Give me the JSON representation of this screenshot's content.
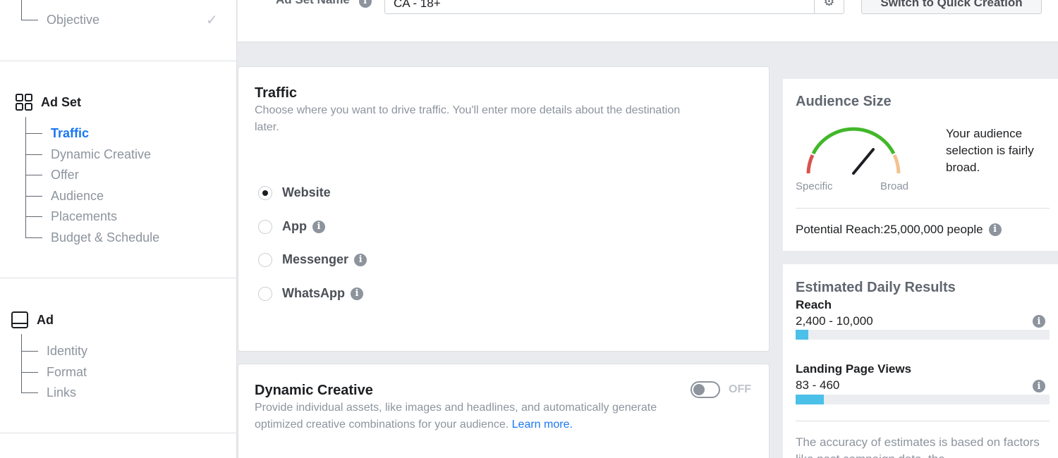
{
  "sidebar": {
    "objective": {
      "label": "Objective",
      "check": "✓"
    },
    "adset": {
      "title": "Ad Set",
      "items": [
        {
          "label": "Traffic",
          "active": true
        },
        {
          "label": "Dynamic Creative"
        },
        {
          "label": "Offer"
        },
        {
          "label": "Audience"
        },
        {
          "label": "Placements"
        },
        {
          "label": "Budget & Schedule"
        }
      ]
    },
    "ad": {
      "title": "Ad",
      "items": [
        {
          "label": "Identity"
        },
        {
          "label": "Format"
        },
        {
          "label": "Links"
        }
      ]
    }
  },
  "topbar": {
    "name_label": "Ad Set Name",
    "name_value": "CA - 18+",
    "quick_button": "Switch to Quick Creation"
  },
  "traffic": {
    "title": "Traffic",
    "description": "Choose where you want to drive traffic. You'll enter more details about the destination later.",
    "options": [
      {
        "label": "Website",
        "selected": true,
        "info": false
      },
      {
        "label": "App",
        "selected": false,
        "info": true
      },
      {
        "label": "Messenger",
        "selected": false,
        "info": true
      },
      {
        "label": "WhatsApp",
        "selected": false,
        "info": true
      }
    ]
  },
  "dynamic_creative": {
    "title": "Dynamic Creative",
    "description": "Provide individual assets, like images and headlines, and automatically generate optimized creative combinations for your audience.",
    "learn_more": "Learn more.",
    "toggle_state": "OFF"
  },
  "audience_size": {
    "title": "Audience Size",
    "gauge_left": "Specific",
    "gauge_right": "Broad",
    "gauge_level": 0.72,
    "summary": "Your audience selection is fairly broad.",
    "potential_reach": "Potential Reach:25,000,000 people"
  },
  "daily_results": {
    "title": "Estimated Daily Results",
    "reach_label": "Reach",
    "reach_value": "2,400 - 10,000",
    "reach_fraction": 0.05,
    "lpv_label": "Landing Page Views",
    "lpv_value": "83 - 460",
    "lpv_fraction": 0.11,
    "footnote": "The accuracy of estimates is based on factors like past campaign data, the"
  },
  "colors": {
    "accent": "#1877f2",
    "bar": "#4bc0e8",
    "gauge_green": "#42b72a",
    "gauge_red": "#d9534f",
    "gauge_peach": "#f3c28f"
  }
}
